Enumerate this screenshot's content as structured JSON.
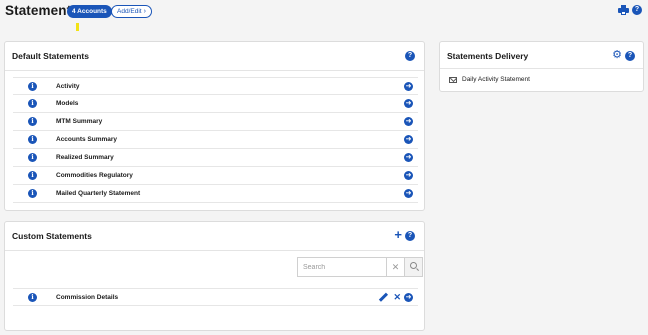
{
  "header": {
    "title": "Statements",
    "accounts_pill": "4 Accounts",
    "add_edit_pill": "Add/Edit",
    "add_edit_chevron": "›",
    "help_glyph": "?"
  },
  "default_statements": {
    "title": "Default Statements",
    "items": [
      {
        "label": "Activity"
      },
      {
        "label": "Models"
      },
      {
        "label": "MTM Summary"
      },
      {
        "label": "Accounts Summary"
      },
      {
        "label": "Realized Summary"
      },
      {
        "label": "Commodities Regulatory"
      },
      {
        "label": "Mailed Quarterly Statement"
      }
    ]
  },
  "custom_statements": {
    "title": "Custom Statements",
    "add_glyph": "+",
    "search": {
      "placeholder": "Search",
      "value": "",
      "clear_glyph": "✕"
    },
    "items": [
      {
        "label": "Commission Details"
      }
    ]
  },
  "statements_delivery": {
    "title": "Statements Delivery",
    "items": [
      {
        "label": "Daily Activity Statement",
        "icon": "envelope-icon"
      }
    ]
  },
  "glyphs": {
    "info": "i",
    "arrow": "➜",
    "close": "✕",
    "gear": "⚙"
  },
  "colors": {
    "accent": "#1a55b8",
    "marker": "#f2e216",
    "background": "#f4f4f4"
  }
}
